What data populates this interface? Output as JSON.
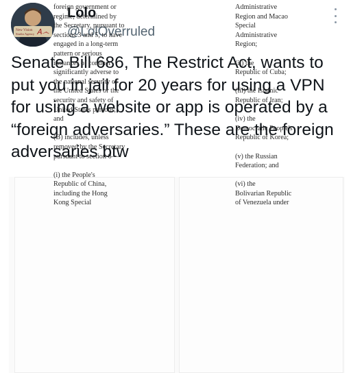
{
  "author": {
    "name": "Lolo",
    "handle": "@LolOverruled",
    "avatar_text": "New Vision Studio Agency"
  },
  "tweet": {
    "text": "Senate Bill 686, The Restrict Act, wants to put you in jail for 20 years for using a VPN for using a website or app is operated by a “foreign adversaries.” These are the foreign adversaries btw"
  },
  "document": {
    "left_column": [
      "foreign government or",
      "regime, determined by",
      "the Secretary, pursuant to",
      "sections 3 and 5, to have",
      "engaged in a long-term",
      "pattern or serious",
      "instances of conduct",
      "significantly adverse to",
      "the national security of",
      "the United States or the",
      "security and safety of",
      "United States persons;",
      "and",
      "",
      "(B) includes, unless",
      "removed by the Secretary",
      "pursuant to section 6—",
      "",
      "(i) the People's",
      "Republic of China,",
      "including the Hong",
      "Kong Special"
    ],
    "right_column": [
      "Administrative",
      "Region and Macao",
      "Special",
      "Administrative",
      "Region;",
      "",
      "(ii) the",
      "Republic of Cuba;",
      "",
      "(iii) the Islamic",
      "Republic of Iran;",
      "",
      "(iv) the",
      "Democratic People's",
      "Republic of Korea;",
      "",
      "(v) the Russian",
      "Federation; and",
      "",
      "(vi) the",
      "Bolivarian Republic",
      "of Venezuela under"
    ]
  },
  "icons": {
    "menu": "more-vertical-icon"
  }
}
